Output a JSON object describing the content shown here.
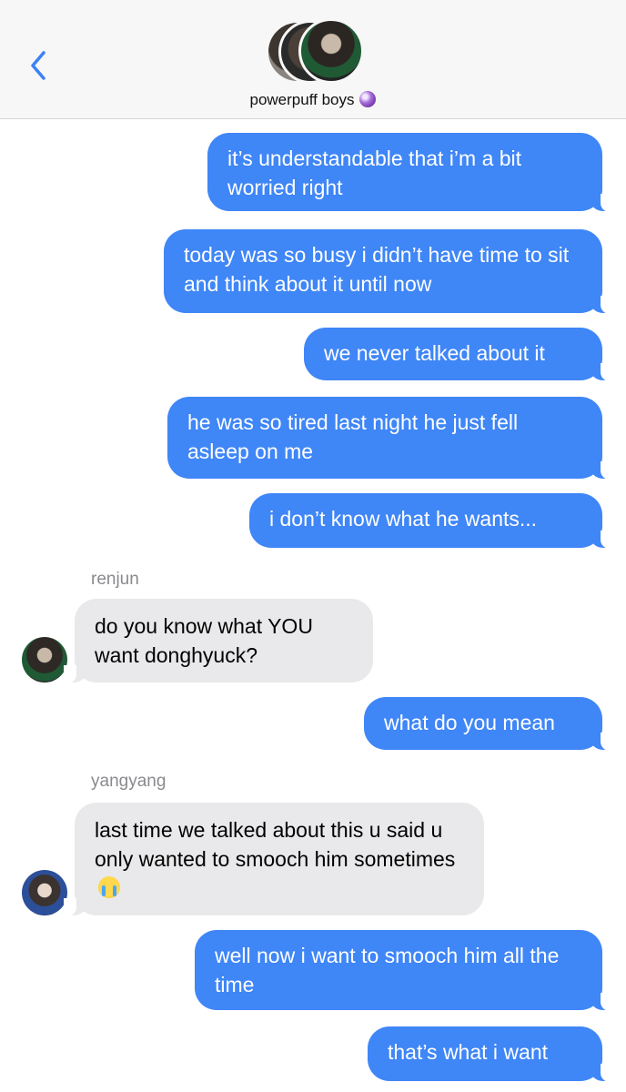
{
  "header": {
    "group_name": "powerpuff boys",
    "group_icon": "crystal-ball-icon",
    "back_icon": "chevron-left-icon"
  },
  "colors": {
    "outgoing": "#3f86f7",
    "incoming": "#e9e9eb",
    "accent": "#3b82f6"
  },
  "messages": [
    {
      "from": "me",
      "text": "it’s understandable that i’m a bit worried right"
    },
    {
      "from": "me",
      "text": "today was so busy i didn’t have time to sit and think about it until now"
    },
    {
      "from": "me",
      "text": "we never talked about it"
    },
    {
      "from": "me",
      "text": "he was so tired last night he just fell asleep on me"
    },
    {
      "from": "me",
      "text": "i don’t know what he wants..."
    },
    {
      "from": "renjun",
      "sender": "renjun",
      "text": "do you know what YOU want donghyuck?"
    },
    {
      "from": "me",
      "text": "what do you mean"
    },
    {
      "from": "yangyang",
      "sender": "yangyang",
      "text": "last time we talked about this u said u only wanted to smooch him sometimes",
      "emoji": "loudly-crying-face-emoji"
    },
    {
      "from": "me",
      "text": "well now i want to smooch him all the time"
    },
    {
      "from": "me",
      "text": "that’s what i want"
    }
  ]
}
